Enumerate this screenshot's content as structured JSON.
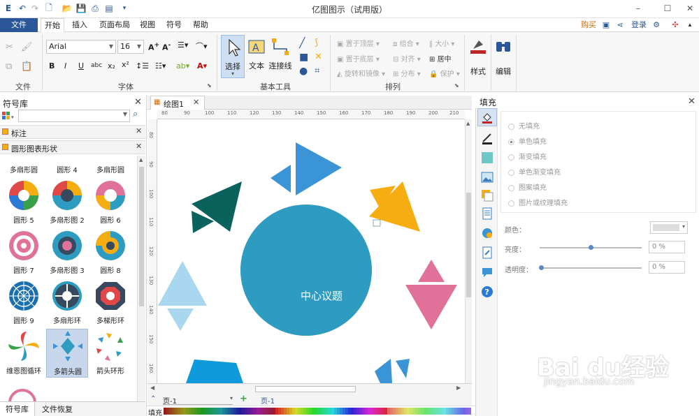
{
  "app": {
    "title": "亿图图示（试用版）"
  },
  "menu": {
    "file": "文件",
    "tabs": [
      "开始",
      "插入",
      "页面布局",
      "视图",
      "符号",
      "帮助"
    ],
    "right": {
      "buy": "购买",
      "login": "登录"
    }
  },
  "ribbon": {
    "groups": {
      "file": "文件",
      "font": "字体",
      "basic": "基本工具",
      "arrange": "排列"
    },
    "font_name": "Arial",
    "font_size": "16",
    "tools": {
      "select": "选择",
      "text": "文本",
      "connector": "连接线",
      "style": "样式",
      "edit": "编辑"
    },
    "arrange_items": [
      "置于顶层",
      "组合",
      "大小",
      "置于底层",
      "对齐",
      "居中",
      "旋转和镜像",
      "分布",
      "保护"
    ]
  },
  "library": {
    "title": "符号库",
    "sections": [
      "标注",
      "圆形图表形状"
    ],
    "shapes": [
      "多扇形圆",
      "圆形 4",
      "多扇形圆",
      "圆形 5",
      "多扇形图 2",
      "圆形 6",
      "圆形 7",
      "多扇形图 3",
      "圆形 8",
      "圆形 9",
      "多扇形环",
      "多梯形环",
      "维恩图循环",
      "多箭头圆",
      "箭头环形"
    ],
    "bottom_tabs": [
      "符号库",
      "文件恢复"
    ]
  },
  "document": {
    "tab": "绘图1",
    "center_text": "中心议题",
    "ruler_h": [
      "80",
      "90",
      "100",
      "110",
      "120",
      "130",
      "140",
      "150",
      "160",
      "170",
      "180",
      "190",
      "200",
      "210"
    ],
    "ruler_v": [
      "80",
      "90",
      "100",
      "110",
      "120",
      "130",
      "140",
      "150",
      "160"
    ],
    "page": {
      "selector": "页-1",
      "sheet": "页-1"
    },
    "fill_label": "填充"
  },
  "fill_panel": {
    "title": "填充",
    "options": [
      "无填充",
      "单色填充",
      "渐变填充",
      "单色渐变填充",
      "图案填充",
      "图片或纹理填充"
    ],
    "selected": "单色填充",
    "props": {
      "color": "颜色：",
      "brightness": "亮度：",
      "brightness_val": "0 %",
      "transparency": "透明度：",
      "transparency_val": "0 %"
    },
    "values": {
      "brightness": 0.5,
      "transparency": 0
    }
  },
  "colors": {
    "accent": "#2b579a",
    "center": "#2e9bc0",
    "green": "#0a625d",
    "blue": "#3a94d6",
    "orange": "#f5ad12",
    "pink": "#e0729a",
    "light": "#a8d7ef",
    "lightblue": "#0f9adb"
  },
  "watermark": {
    "brand": "Bai du经验",
    "url": "jingyan.baidu.com"
  }
}
